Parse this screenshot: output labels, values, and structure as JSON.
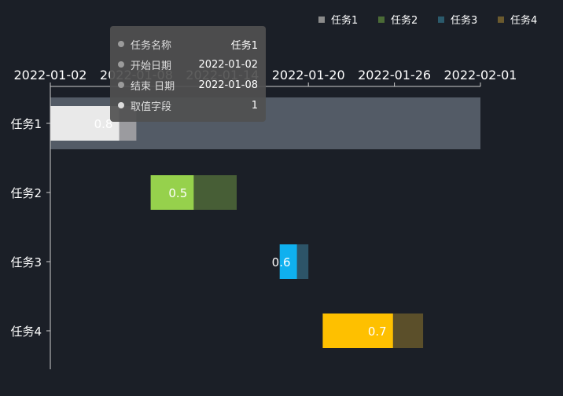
{
  "chart_data": {
    "type": "bar",
    "orientation": "horizontal",
    "categories": [
      "任务1",
      "任务2",
      "任务3",
      "任务4"
    ],
    "x_axis_type": "date",
    "x_axis_position": "top",
    "xlim": [
      "2022-01-02",
      "2022-02-01"
    ],
    "x_ticks": [
      "2022-01-02",
      "2022-01-08",
      "2022-01-14",
      "2022-01-20",
      "2022-01-26",
      "2022-02-01"
    ],
    "series": [
      {
        "name": "任务1",
        "start": "2022-01-02",
        "end": "2022-01-08",
        "progress": 0.8
      },
      {
        "name": "任务2",
        "start": "2022-01-09",
        "end": "2022-01-15",
        "progress": 0.5
      },
      {
        "name": "任务3",
        "start": "2022-01-18",
        "end": "2022-01-20",
        "progress": 0.6
      },
      {
        "name": "任务4",
        "start": "2022-01-21",
        "end": "2022-01-28",
        "progress": 0.7
      }
    ],
    "legend": {
      "placement": "top-right",
      "entries": [
        "任务1",
        "任务2",
        "任务3",
        "任务4"
      ]
    },
    "highlighted_category": "任务1",
    "grid": false
  },
  "colors": {
    "background": "#1b1f27",
    "axis": "#cccccc",
    "highlight_band": "#535b66",
    "series_progress": [
      "#e9e9e9",
      "#96d14c",
      "#0fb0ef",
      "#fec000"
    ],
    "series_rest": [
      "#9b9b9f",
      "#475e36",
      "#2d5468",
      "#5b4f2a"
    ],
    "legend_swatch": [
      "#8b8b8b",
      "#4b6b36",
      "#2b5a6c",
      "#6b5a2e"
    ]
  },
  "tooltip": {
    "rows": [
      {
        "label": "任务名称",
        "value": "任务1"
      },
      {
        "label": "开始日期",
        "value": "2022-01-02"
      },
      {
        "label": "结束 日期",
        "value": "2022-01-08"
      },
      {
        "label": "取值字段",
        "value": "1"
      }
    ],
    "dot_colors": [
      "#9b9b9b",
      "#9b9b9b",
      "#9b9b9b",
      "#dddddd"
    ]
  }
}
